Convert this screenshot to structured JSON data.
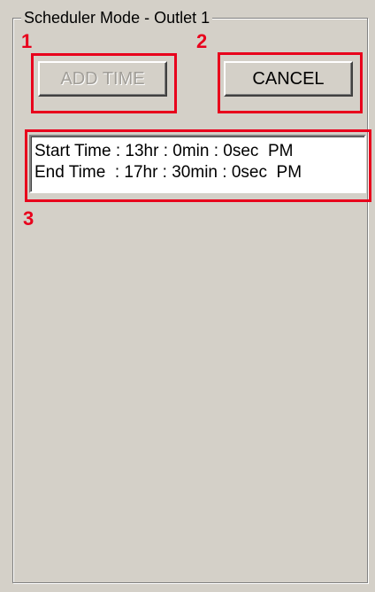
{
  "group": {
    "title": "Scheduler Mode - Outlet 1"
  },
  "buttons": {
    "add_time": "ADD TIME",
    "cancel": "CANCEL"
  },
  "schedule_list": [
    "Start Time : 13hr : 0min : 0sec  PM",
    "End Time  : 17hr : 30min : 0sec  PM"
  ],
  "annotations": {
    "one": "1",
    "two": "2",
    "three": "3",
    "color": "#e8001c"
  },
  "colors": {
    "panel_bg": "#d4d0c8",
    "disabled_text": "#a19e98"
  }
}
